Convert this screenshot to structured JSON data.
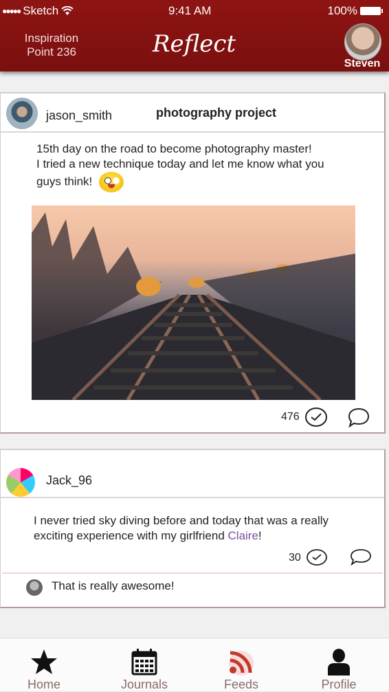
{
  "status_bar": {
    "carrier": "Sketch",
    "time": "9:41 AM",
    "battery": "100%"
  },
  "header": {
    "location_line1": "Inspiration",
    "location_line2": "Point 236",
    "app_title": "Reflect",
    "user_name": "Steven"
  },
  "posts": [
    {
      "username": "jason_smith",
      "title": "photography project",
      "text_line1": "15th day on the road to become photography master!",
      "text_line2": "I tried a new technique today and let me know what you",
      "text_line3": "guys think!",
      "likes": "476"
    },
    {
      "username": "Jack_96",
      "text_line1": "I never tried sky diving before and today that was a really",
      "text_line2_prefix": "exciting experience with my girlfriend ",
      "mention": "Claire",
      "text_line2_suffix": "!",
      "likes": "30",
      "comment": "That is really awesome!"
    }
  ],
  "tabs": [
    {
      "label": "Home",
      "icon": "star-icon"
    },
    {
      "label": "Journals",
      "icon": "calendar-icon"
    },
    {
      "label": "Feeds",
      "icon": "rss-icon"
    },
    {
      "label": "Profile",
      "icon": "person-icon"
    }
  ],
  "colors": {
    "header": "#8e1413",
    "active_tab": "#c0392b",
    "mention": "#7a4fa0"
  }
}
